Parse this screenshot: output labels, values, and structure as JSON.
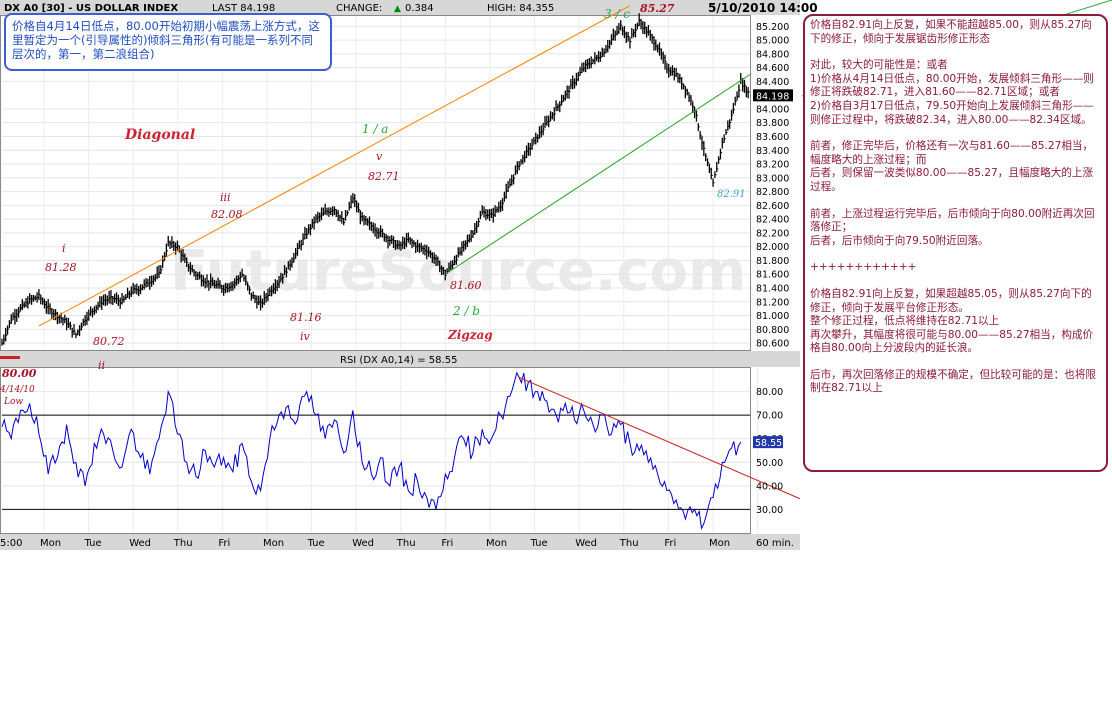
{
  "header": {
    "symbol": "DX A0 [30] - US DOLLAR INDEX",
    "last": "LAST 84.198",
    "change_label": "CHANGE:",
    "change_value": "0.384",
    "high": "HIGH: 84.355",
    "date": "5/10/2010 14:00"
  },
  "watermark": "FutureSource.com",
  "top_note": "价格自4月14日低点，80.00开始初期小幅震荡上涨方式，这里暂定为一个(引导属性的)倾斜三角形(有可能是一系列不同层次的，第一，第二浪组合)",
  "annotations": {
    "diagonal": "Diagonal",
    "zigzag": "Zigzag",
    "wave_i": "i",
    "wave_i_price": "81.28",
    "wave_ii": "ii",
    "wave_ii_price": "80.72",
    "wave_iii": "iii",
    "wave_iii_price": "82.08",
    "wave_iv": "iv",
    "wave_iv_price": "81.16",
    "wave_v": "v",
    "wave_v_price": "82.71",
    "wave_1a": "1 / a",
    "wave_2b": "2 / b",
    "wave_2b_price": "81.60",
    "wave_3c": "3 / c",
    "wave_3c_price": "85.27",
    "low_price": "80.00",
    "low_date": "4/14/10",
    "low_label": "Low",
    "recent_low": "82.91"
  },
  "price_axis_labels": [
    "85.200",
    "85.000",
    "84.800",
    "84.600",
    "84.400",
    "84.198",
    "84.000",
    "83.800",
    "83.600",
    "83.400",
    "83.200",
    "83.000",
    "82.800",
    "82.600",
    "82.400",
    "82.200",
    "82.000",
    "81.800",
    "81.600",
    "81.400",
    "81.200",
    "81.000",
    "80.800",
    "80.600"
  ],
  "rsi": {
    "title": "RSI (DX A0,14) = 58.55",
    "current": "58.55",
    "axis_labels": [
      "80.00",
      "70.00",
      "60.00",
      "50.00",
      "40.00",
      "30.00"
    ]
  },
  "time_axis": {
    "labels": [
      "5:00",
      "Mon",
      "Tue",
      "Wed",
      "Thu",
      "Fri",
      "Mon",
      "Tue",
      "Wed",
      "Thu",
      "Fri",
      "Mon",
      "Tue",
      "Wed",
      "Thu",
      "Fri",
      "Mon"
    ],
    "interval": "60 min."
  },
  "right_panel": [
    "价格自82.91向上反复，如果不能超越85.00，则从85.27向下的修正，倾向于发展锯齿形修正形态",
    "对此，较大的可能性是：或者\n1)价格从4月14日低点，80.00开始，发展倾斜三角形——则修正将跌破82.71，进入81.60——82.71区域；或者\n2)价格自3月17日低点，79.50开始向上发展倾斜三角形——则修正过程中，将跌破82.34，进入80.00——82.34区域。",
    "前者，修正完毕后，价格还有一次与81.60——85.27相当，幅度略大的上涨过程；而\n后者，则保留一波类似80.00——85.27，且幅度略大的上涨过程。",
    "前者，上涨过程运行完毕后，后市倾向于向80.00附近再次回落修正；\n后者，后市倾向于向79.50附近回落。",
    "++++++++++++",
    "价格自82.91向上反复，如果超越85.05，则从85.27向下的修正，倾向于发展平台修正形态。\n整个修正过程，低点将维持在82.71以上\n再次攀升，其幅度将很可能与80.00——85.27相当，构成价格自80.00向上分波段内的延长浪。",
    "后市，再次回落修正的规模不确定，但比较可能的是：也将限制在82.71以上"
  ],
  "chart_data": [
    {
      "type": "line",
      "title": "DX A0 [30] - US DOLLAR INDEX",
      "interval": "60 min.",
      "ylim": [
        80.5,
        85.35
      ],
      "x_ticks": [
        "5:00",
        "Mon",
        "Tue",
        "Wed",
        "Thu",
        "Fri",
        "Mon",
        "Tue",
        "Wed",
        "Thu",
        "Fri",
        "Mon",
        "Tue",
        "Wed",
        "Thu",
        "Fri",
        "Mon"
      ],
      "grid": true,
      "colors": {
        "price": "#000000",
        "upper_channel": "#ff8000",
        "lower_channel": "#22aa22"
      },
      "series": [
        {
          "name": "DX A0",
          "anchors": [
            [
              0,
              80.6
            ],
            [
              1,
              80.95
            ],
            [
              2,
              81.1
            ],
            [
              3,
              81.22
            ],
            [
              4,
              81.28
            ],
            [
              5,
              81.1
            ],
            [
              6,
              81.0
            ],
            [
              7,
              80.9
            ],
            [
              8,
              80.72
            ],
            [
              9,
              80.95
            ],
            [
              10,
              81.1
            ],
            [
              11,
              81.22
            ],
            [
              12,
              81.25
            ],
            [
              13,
              81.2
            ],
            [
              14,
              81.35
            ],
            [
              15,
              81.4
            ],
            [
              16,
              81.5
            ],
            [
              17,
              81.6
            ],
            [
              18,
              82.05
            ],
            [
              19,
              82.0
            ],
            [
              20,
              81.75
            ],
            [
              21,
              81.6
            ],
            [
              22,
              81.5
            ],
            [
              23,
              81.45
            ],
            [
              24,
              81.4
            ],
            [
              25,
              81.45
            ],
            [
              26,
              81.6
            ],
            [
              27,
              81.3
            ],
            [
              28,
              81.16
            ],
            [
              29,
              81.35
            ],
            [
              30,
              81.5
            ],
            [
              31,
              81.7
            ],
            [
              32,
              81.95
            ],
            [
              33,
              82.2
            ],
            [
              34,
              82.4
            ],
            [
              35,
              82.5
            ],
            [
              36,
              82.55
            ],
            [
              37,
              82.35
            ],
            [
              38,
              82.71
            ],
            [
              39,
              82.4
            ],
            [
              40,
              82.3
            ],
            [
              41,
              82.2
            ],
            [
              42,
              82.1
            ],
            [
              43,
              82.0
            ],
            [
              44,
              82.1
            ],
            [
              45,
              82.0
            ],
            [
              46,
              81.95
            ],
            [
              47,
              81.8
            ],
            [
              48,
              81.6
            ],
            [
              49,
              81.8
            ],
            [
              50,
              82.0
            ],
            [
              51,
              82.2
            ],
            [
              52,
              82.5
            ],
            [
              53,
              82.45
            ],
            [
              54,
              82.6
            ],
            [
              55,
              82.9
            ],
            [
              56,
              83.2
            ],
            [
              57,
              83.4
            ],
            [
              58,
              83.6
            ],
            [
              59,
              83.8
            ],
            [
              60,
              84.0
            ],
            [
              61,
              84.2
            ],
            [
              62,
              84.4
            ],
            [
              63,
              84.6
            ],
            [
              64,
              84.7
            ],
            [
              65,
              84.8
            ],
            [
              66,
              85.0
            ],
            [
              67,
              85.2
            ],
            [
              68,
              85.0
            ],
            [
              69,
              85.27
            ],
            [
              70,
              85.1
            ],
            [
              71,
              84.9
            ],
            [
              72,
              84.6
            ],
            [
              73,
              84.5
            ],
            [
              74,
              84.3
            ],
            [
              75,
              84.0
            ],
            [
              76,
              83.4
            ],
            [
              77,
              82.91
            ],
            [
              78,
              83.5
            ],
            [
              79,
              83.9
            ],
            [
              80,
              84.4
            ],
            [
              81,
              84.198
            ]
          ]
        },
        {
          "name": "upper channel",
          "anchors": [
            [
              4,
              80.85
            ],
            [
              68,
              85.5
            ]
          ]
        },
        {
          "name": "lower channel",
          "anchors": [
            [
              48,
              81.6
            ],
            [
              81,
              84.5
            ]
          ]
        }
      ]
    },
    {
      "type": "line",
      "title": "RSI (DX A0,14) = 58.55",
      "ylim": [
        20,
        90
      ],
      "reference_lines": [
        70,
        30
      ],
      "grid": true,
      "colors": {
        "rsi": "#0000cc",
        "trendline": "#cc2222",
        "reference": "#000000"
      },
      "series": [
        {
          "name": "RSI (DX A0,14)",
          "anchors": [
            [
              0,
              65
            ],
            [
              1,
              60
            ],
            [
              2,
              72
            ],
            [
              3,
              75
            ],
            [
              4,
              62
            ],
            [
              5,
              45
            ],
            [
              6,
              52
            ],
            [
              7,
              66
            ],
            [
              8,
              50
            ],
            [
              9,
              40
            ],
            [
              10,
              58
            ],
            [
              11,
              62
            ],
            [
              12,
              55
            ],
            [
              13,
              48
            ],
            [
              14,
              64
            ],
            [
              15,
              52
            ],
            [
              16,
              45
            ],
            [
              17,
              60
            ],
            [
              18,
              80
            ],
            [
              19,
              62
            ],
            [
              20,
              50
            ],
            [
              21,
              44
            ],
            [
              22,
              55
            ],
            [
              23,
              48
            ],
            [
              24,
              52
            ],
            [
              25,
              46
            ],
            [
              26,
              58
            ],
            [
              27,
              42
            ],
            [
              28,
              38
            ],
            [
              29,
              60
            ],
            [
              30,
              70
            ],
            [
              31,
              74
            ],
            [
              32,
              68
            ],
            [
              33,
              80
            ],
            [
              34,
              70
            ],
            [
              35,
              60
            ],
            [
              36,
              68
            ],
            [
              37,
              54
            ],
            [
              38,
              72
            ],
            [
              39,
              50
            ],
            [
              40,
              45
            ],
            [
              41,
              52
            ],
            [
              42,
              40
            ],
            [
              43,
              48
            ],
            [
              44,
              38
            ],
            [
              45,
              42
            ],
            [
              46,
              35
            ],
            [
              47,
              30
            ],
            [
              48,
              45
            ],
            [
              49,
              52
            ],
            [
              50,
              60
            ],
            [
              51,
              54
            ],
            [
              52,
              64
            ],
            [
              53,
              60
            ],
            [
              54,
              70
            ],
            [
              55,
              78
            ],
            [
              56,
              86
            ],
            [
              57,
              84
            ],
            [
              58,
              80
            ],
            [
              59,
              76
            ],
            [
              60,
              70
            ],
            [
              61,
              75
            ],
            [
              62,
              68
            ],
            [
              63,
              72
            ],
            [
              64,
              66
            ],
            [
              65,
              70
            ],
            [
              66,
              62
            ],
            [
              67,
              66
            ],
            [
              68,
              58
            ],
            [
              69,
              55
            ],
            [
              70,
              50
            ],
            [
              71,
              45
            ],
            [
              72,
              38
            ],
            [
              73,
              34
            ],
            [
              74,
              26
            ],
            [
              75,
              30
            ],
            [
              76,
              24
            ],
            [
              77,
              35
            ],
            [
              78,
              50
            ],
            [
              79,
              56
            ],
            [
              80,
              58.55
            ]
          ]
        },
        {
          "name": "trendline",
          "anchors": [
            [
              56,
              86
            ],
            [
              82,
              42
            ]
          ]
        }
      ]
    }
  ]
}
